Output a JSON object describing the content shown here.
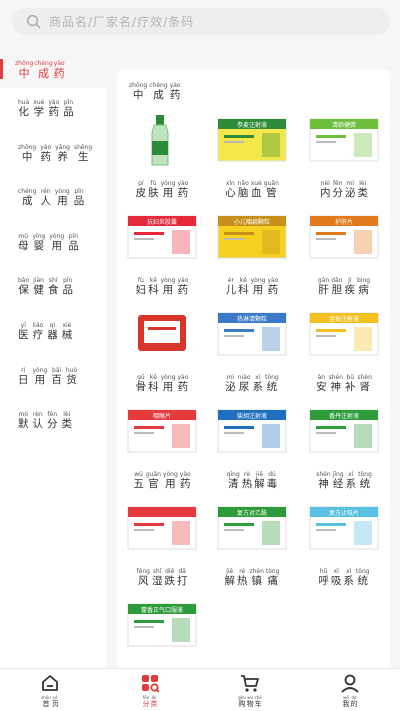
{
  "search": {
    "placeholder": "商品名/厂家名/疗效/条码"
  },
  "page_title": {
    "chars": [
      {
        "py": "zhōng",
        "hz": "中"
      },
      {
        "py": "chéng",
        "hz": "成"
      },
      {
        "py": "yào",
        "hz": "药"
      }
    ]
  },
  "sidebar": {
    "items": [
      {
        "chars": [
          {
            "py": "huà",
            "hz": "化"
          },
          {
            "py": "xué",
            "hz": "学"
          },
          {
            "py": "yào",
            "hz": "药"
          },
          {
            "py": "pǐn",
            "hz": "品"
          }
        ]
      },
      {
        "chars": [
          {
            "py": "zhōng",
            "hz": "中"
          },
          {
            "py": "yào",
            "hz": "药"
          },
          {
            "py": "yǎng",
            "hz": "养"
          },
          {
            "py": "shēng",
            "hz": "生"
          }
        ]
      },
      {
        "chars": [
          {
            "py": "chéng",
            "hz": "成"
          },
          {
            "py": "rén",
            "hz": "人"
          },
          {
            "py": "yòng",
            "hz": "用"
          },
          {
            "py": "pǐn",
            "hz": "品"
          }
        ]
      },
      {
        "chars": [
          {
            "py": "mǔ",
            "hz": "母"
          },
          {
            "py": "yīng",
            "hz": "婴"
          },
          {
            "py": "yòng",
            "hz": "用"
          },
          {
            "py": "pǐn",
            "hz": "品"
          }
        ]
      },
      {
        "chars": [
          {
            "py": "bǎo",
            "hz": "保"
          },
          {
            "py": "jiàn",
            "hz": "健"
          },
          {
            "py": "shí",
            "hz": "食"
          },
          {
            "py": "pǐn",
            "hz": "品"
          }
        ]
      },
      {
        "chars": [
          {
            "py": "yī",
            "hz": "医"
          },
          {
            "py": "liáo",
            "hz": "疗"
          },
          {
            "py": "qì",
            "hz": "器"
          },
          {
            "py": "xiè",
            "hz": "械"
          }
        ]
      },
      {
        "chars": [
          {
            "py": "rì",
            "hz": "日"
          },
          {
            "py": "yòng",
            "hz": "用"
          },
          {
            "py": "bǎi",
            "hz": "百"
          },
          {
            "py": "huò",
            "hz": "货"
          }
        ]
      },
      {
        "chars": [
          {
            "py": "mò",
            "hz": "默"
          },
          {
            "py": "rèn",
            "hz": "认"
          },
          {
            "py": "fēn",
            "hz": "分"
          },
          {
            "py": "lèi",
            "hz": "类"
          }
        ]
      }
    ]
  },
  "card_title": {
    "chars": [
      {
        "py": "zhōng",
        "hz": "中"
      },
      {
        "py": "chéng",
        "hz": "成"
      },
      {
        "py": "yào",
        "hz": "药"
      }
    ]
  },
  "products": [
    {
      "chars": [
        {
          "py": "pí",
          "hz": "皮"
        },
        {
          "py": "fū",
          "hz": "肤"
        },
        {
          "py": "yòng",
          "hz": "用"
        },
        {
          "py": "yào",
          "hz": "药"
        }
      ]
    },
    {
      "chars": [
        {
          "py": "xīn",
          "hz": "心"
        },
        {
          "py": "nǎo",
          "hz": "脑"
        },
        {
          "py": "xuè",
          "hz": "血"
        },
        {
          "py": "guǎn",
          "hz": "管"
        }
      ]
    },
    {
      "chars": [
        {
          "py": "nèi",
          "hz": "内"
        },
        {
          "py": "fēn",
          "hz": "分"
        },
        {
          "py": "mì",
          "hz": "泌"
        },
        {
          "py": "lèi",
          "hz": "类"
        }
      ]
    },
    {
      "chars": [
        {
          "py": "fù",
          "hz": "妇"
        },
        {
          "py": "kē",
          "hz": "科"
        },
        {
          "py": "yòng",
          "hz": "用"
        },
        {
          "py": "yào",
          "hz": "药"
        }
      ]
    },
    {
      "chars": [
        {
          "py": "ér",
          "hz": "儿"
        },
        {
          "py": "kē",
          "hz": "科"
        },
        {
          "py": "yòng",
          "hz": "用"
        },
        {
          "py": "yào",
          "hz": "药"
        }
      ]
    },
    {
      "chars": [
        {
          "py": "gān",
          "hz": "肝"
        },
        {
          "py": "dǎn",
          "hz": "胆"
        },
        {
          "py": "jí",
          "hz": "疾"
        },
        {
          "py": "bìng",
          "hz": "病"
        }
      ]
    },
    {
      "chars": [
        {
          "py": "gǔ",
          "hz": "骨"
        },
        {
          "py": "kē",
          "hz": "科"
        },
        {
          "py": "yòng",
          "hz": "用"
        },
        {
          "py": "yào",
          "hz": "药"
        }
      ]
    },
    {
      "chars": [
        {
          "py": "mì",
          "hz": "泌"
        },
        {
          "py": "niào",
          "hz": "尿"
        },
        {
          "py": "xì",
          "hz": "系"
        },
        {
          "py": "tǒng",
          "hz": "统"
        }
      ]
    },
    {
      "chars": [
        {
          "py": "ān",
          "hz": "安"
        },
        {
          "py": "shén",
          "hz": "神"
        },
        {
          "py": "bǔ",
          "hz": "补"
        },
        {
          "py": "shèn",
          "hz": "肾"
        }
      ]
    },
    {
      "chars": [
        {
          "py": "wǔ",
          "hz": "五"
        },
        {
          "py": "guān",
          "hz": "官"
        },
        {
          "py": "yòng",
          "hz": "用"
        },
        {
          "py": "yào",
          "hz": "药"
        }
      ]
    },
    {
      "chars": [
        {
          "py": "qīng",
          "hz": "清"
        },
        {
          "py": "rè",
          "hz": "热"
        },
        {
          "py": "jiě",
          "hz": "解"
        },
        {
          "py": "dú",
          "hz": "毒"
        }
      ]
    },
    {
      "chars": [
        {
          "py": "shén",
          "hz": "神"
        },
        {
          "py": "jīng",
          "hz": "经"
        },
        {
          "py": "xì",
          "hz": "系"
        },
        {
          "py": "tǒng",
          "hz": "统"
        }
      ]
    },
    {
      "chars": [
        {
          "py": "fēng",
          "hz": "风"
        },
        {
          "py": "shī",
          "hz": "湿"
        },
        {
          "py": "diē",
          "hz": "跌"
        },
        {
          "py": "dǎ",
          "hz": "打"
        }
      ]
    },
    {
      "chars": [
        {
          "py": "jiě",
          "hz": "解"
        },
        {
          "py": "rè",
          "hz": "热"
        },
        {
          "py": "zhèn",
          "hz": "镇"
        },
        {
          "py": "tòng",
          "hz": "痛"
        }
      ]
    },
    {
      "chars": [
        {
          "py": "hū",
          "hz": "呼"
        },
        {
          "py": "xī",
          "hz": "吸"
        },
        {
          "py": "xì",
          "hz": "系"
        },
        {
          "py": "tǒng",
          "hz": "统"
        }
      ]
    },
    {
      "chars": []
    }
  ],
  "product_images": [
    {
      "kind": "bottle",
      "text": ""
    },
    {
      "kind": "box",
      "text": "参麦注射液"
    },
    {
      "kind": "box",
      "text": "清肺健脾"
    },
    {
      "kind": "box",
      "text": "抗妇炎胶囊"
    },
    {
      "kind": "box",
      "text": "小儿咽扁颗粒"
    },
    {
      "kind": "box",
      "text": "护肝片"
    },
    {
      "kind": "box",
      "text": ""
    },
    {
      "kind": "box",
      "text": "热淋清颗粒"
    },
    {
      "kind": "box",
      "text": "金振注射液"
    },
    {
      "kind": "box",
      "text": "咽喉片"
    },
    {
      "kind": "box",
      "text": "柴胡注射液"
    },
    {
      "kind": "box",
      "text": "香丹注射液"
    },
    {
      "kind": "box",
      "text": ""
    },
    {
      "kind": "box",
      "text": "复方对乙酰"
    },
    {
      "kind": "box",
      "text": "复方止咳片"
    },
    {
      "kind": "box",
      "text": "藿香正气口服液"
    }
  ],
  "bottom_nav": [
    {
      "icon": "home-icon",
      "chars": [
        {
          "py": "shǒu",
          "hz": "首"
        },
        {
          "py": "yè",
          "hz": "页"
        }
      ]
    },
    {
      "icon": "category-icon",
      "chars": [
        {
          "py": "fēn",
          "hz": "分"
        },
        {
          "py": "lèi",
          "hz": "类"
        }
      ],
      "active": true
    },
    {
      "icon": "cart-icon",
      "chars": [
        {
          "py": "gòu",
          "hz": "购"
        },
        {
          "py": "wù",
          "hz": "物"
        },
        {
          "py": "chē",
          "hz": "车"
        }
      ]
    },
    {
      "icon": "user-icon",
      "chars": [
        {
          "py": "wǒ",
          "hz": "我"
        },
        {
          "py": "de",
          "hz": "的"
        }
      ]
    }
  ],
  "colors": {
    "accent": "#e5393b",
    "background": "#f6f6f6",
    "card": "#ffffff"
  }
}
